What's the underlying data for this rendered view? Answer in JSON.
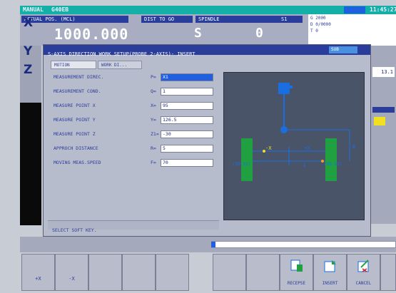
{
  "colors": {
    "header_teal": "#14b0a8",
    "title_blue": "#2a3d9a",
    "dialog_bg": "#b7bccc",
    "diagram_bg": "#4a5468",
    "probe_blue": "#1a6ee0",
    "block_green": "#20a040",
    "marker_yellow": "#f0e020",
    "softkey_bg": "#b8bccb"
  },
  "header": {
    "mode": "MANUAL",
    "program": "G40EB",
    "time": "11:45:27"
  },
  "position_panel": {
    "actual_label": "ACTUAL POS. (MCL)",
    "dist_label": "DIST TO GO",
    "spindle_label": "SPINDLE",
    "spindle_code": "S1",
    "axes": [
      "X",
      "Y",
      "Z"
    ],
    "x_value": "1000.000",
    "s_label": "S",
    "s_value": "0"
  },
  "info_box": {
    "line1": "G 2000",
    "line2": "D 0/0000",
    "line3": "T 0"
  },
  "right_col": {
    "value": "13.1"
  },
  "dialog": {
    "title": "S-AXIS DIRECTION WORK SETUP(PROBE 2-AXIS)- INSERT",
    "title_code": "SUB",
    "tabs": [
      "MOTION",
      "WORK DI..."
    ],
    "rows": [
      {
        "label": "MEASUREMENT DIREC.",
        "prefix": "P=",
        "value": "X1"
      },
      {
        "label": "MEASUREMENT COND.",
        "prefix": "Q=",
        "value": "1"
      },
      {
        "label": "MEASURE POINT X",
        "prefix": "X=",
        "value": "95"
      },
      {
        "label": "MEASURE POINT Y",
        "prefix": "Y=",
        "value": "126.5"
      },
      {
        "label": "MEASURE POINT Z",
        "prefix": "Z1=",
        "value": "-30"
      },
      {
        "label": "APPROCH DISTANCE",
        "prefix": "R=",
        "value": "5"
      },
      {
        "label": "MOVING MEAS.SPEED",
        "prefix": "F=",
        "value": "70"
      }
    ],
    "status": "SELECT SOFT KEY."
  },
  "diagram": {
    "left_block_label": "(X0,X1)",
    "right_block_label": "(X0,X1)",
    "dim_a": "-X",
    "dim_b": "+X",
    "dim_label_v": "B",
    "dim_label_small": "X"
  },
  "softkeys": [
    {
      "label": "",
      "symbol": "+X"
    },
    {
      "label": "",
      "symbol": "-X"
    },
    {
      "label": "",
      "symbol": ""
    },
    {
      "label": "",
      "symbol": ""
    },
    {
      "label": "",
      "symbol": ""
    },
    {
      "label": "",
      "symbol": ""
    },
    {
      "label": "",
      "symbol": ""
    },
    {
      "label": "RECEPSE",
      "symbol": ""
    },
    {
      "label": "INSERT",
      "symbol": ""
    },
    {
      "label": "CANCEL",
      "symbol": ""
    },
    {
      "label": "",
      "symbol": ""
    }
  ]
}
